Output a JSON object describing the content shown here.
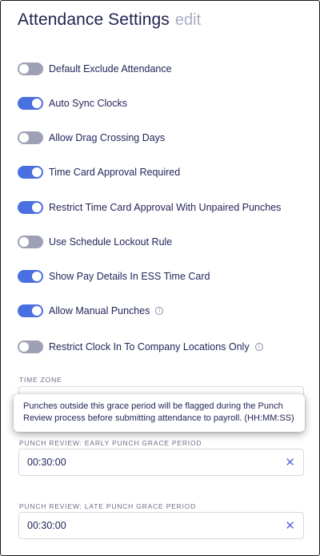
{
  "header": {
    "title": "Attendance Settings",
    "edit_label": "edit"
  },
  "toggles": [
    {
      "label": "Default Exclude Attendance",
      "on": false
    },
    {
      "label": "Auto Sync Clocks",
      "on": true
    },
    {
      "label": "Allow Drag Crossing Days",
      "on": false
    },
    {
      "label": "Time Card Approval Required",
      "on": true
    },
    {
      "label": "Restrict Time Card Approval With Unpaired Punches",
      "on": true
    },
    {
      "label": "Use Schedule Lockout Rule",
      "on": false
    },
    {
      "label": "Show Pay Details In ESS Time Card",
      "on": true
    },
    {
      "label": "Allow Manual Punches",
      "on": true
    },
    {
      "label": "Restrict Clock In To Company Locations Only",
      "on": false
    }
  ],
  "time_zone": {
    "label": "TIME ZONE"
  },
  "tooltip": {
    "text": "Punches outside this grace period will be flagged during the Punch Review process before submitting attendance to payroll. (HH:MM:SS)"
  },
  "early_grace": {
    "label": "PUNCH REVIEW: EARLY PUNCH GRACE PERIOD",
    "value": "00:30:00"
  },
  "late_grace": {
    "label": "PUNCH REVIEW: LATE PUNCH GRACE PERIOD",
    "value": "00:30:00"
  },
  "colors": {
    "toggle_on": "#4a6fe0",
    "toggle_off": "#9ea0b5",
    "title": "#1f2150",
    "edit": "#a9acc6"
  },
  "icons": {
    "info": "info-circle-icon",
    "clear": "x-clear-icon"
  }
}
